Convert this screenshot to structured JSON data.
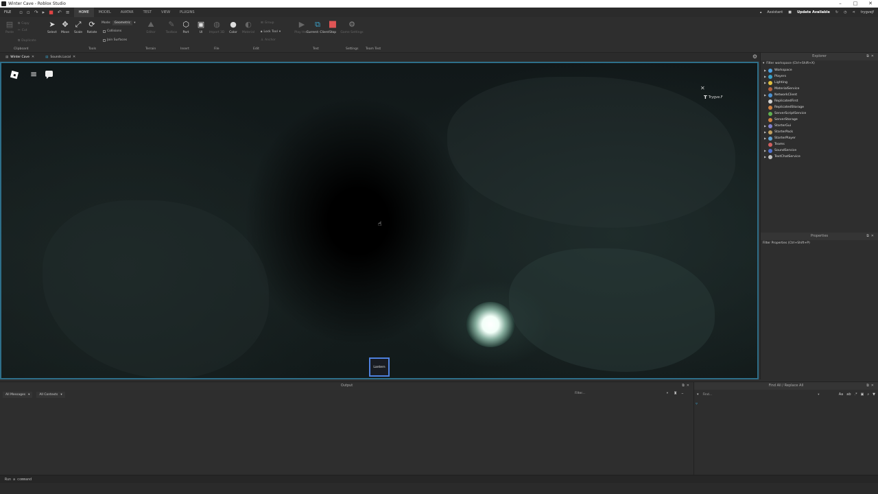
{
  "window": {
    "title": "Winter Cave - Roblox Studio",
    "min": "–",
    "max": "□",
    "close": "✕"
  },
  "menubar": {
    "file": "FILE",
    "tabs": [
      "HOME",
      "MODEL",
      "AVATAR",
      "TEST",
      "VIEW",
      "PLUGINS"
    ],
    "active_tab": "HOME",
    "assistant": "Assistant",
    "update": "Update Available",
    "user": "trygvejf"
  },
  "ribbon": {
    "paste": "Paste",
    "copy": "Copy",
    "cut": "Cut",
    "duplicate": "Duplicate",
    "select": "Select",
    "move": "Move",
    "scale": "Scale",
    "rotate": "Rotate",
    "mode_label": "Mode:",
    "mode_value": "Geometric",
    "collisions": "Collisions",
    "join_surfaces": "Join Surfaces",
    "editor": "Editor",
    "toolbox": "Toolbox",
    "part": "Part",
    "ui": "UI",
    "import3d": "Import 3D",
    "color": "Color",
    "material": "Material",
    "group": "Group",
    "lock_tool": "Lock Tool",
    "anchor": "Anchor",
    "play_here": "Play Here",
    "current_client": "Current: Client",
    "stop": "Stop",
    "game_settings": "Game Settings",
    "groups": [
      "Clipboard",
      "Tools",
      "Terrain",
      "Insert",
      "File",
      "Edit",
      "Test",
      "Settings",
      "Team Test"
    ]
  },
  "doc_tabs": [
    {
      "label": "Winter Cave",
      "active": true
    },
    {
      "label": "Sounds.Local",
      "active": false
    }
  ],
  "viewport": {
    "player_name": "Trygve.F",
    "hotbar_item": "Lantern"
  },
  "explorer": {
    "title": "Explorer",
    "filter": "Filter workspace (Ctrl+Shift+X)",
    "items": [
      {
        "label": "Workspace",
        "color": "#4a9fe0",
        "expandable": true
      },
      {
        "label": "Players",
        "color": "#3aa0c8",
        "expandable": true
      },
      {
        "label": "Lighting",
        "color": "#e0c040",
        "expandable": true
      },
      {
        "label": "MaterialService",
        "color": "#b06040",
        "expandable": false
      },
      {
        "label": "NetworkClient",
        "color": "#4a90d0",
        "expandable": true
      },
      {
        "label": "ReplicatedFirst",
        "color": "#d0d0d0",
        "expandable": false
      },
      {
        "label": "ReplicatedStorage",
        "color": "#d08040",
        "expandable": false
      },
      {
        "label": "ServerScriptService",
        "color": "#60b050",
        "expandable": false
      },
      {
        "label": "ServerStorage",
        "color": "#d08040",
        "expandable": false
      },
      {
        "label": "StarterGui",
        "color": "#8080d0",
        "expandable": true
      },
      {
        "label": "StarterPack",
        "color": "#c0a060",
        "expandable": true
      },
      {
        "label": "StarterPlayer",
        "color": "#60a0d0",
        "expandable": true
      },
      {
        "label": "Teams",
        "color": "#d06060",
        "expandable": false
      },
      {
        "label": "SoundService",
        "color": "#5070d0",
        "expandable": true
      },
      {
        "label": "TextChatService",
        "color": "#c0c0c0",
        "expandable": true
      }
    ]
  },
  "properties": {
    "title": "Properties",
    "filter": "Filter Properties (Ctrl+Shift+P)"
  },
  "output": {
    "title": "Output",
    "messages_filter": "All Messages",
    "contexts_filter": "All Contexts",
    "filter_placeholder": "Filter..."
  },
  "findall": {
    "title": "Find All / Replace All",
    "find_placeholder": "Find..."
  },
  "commandbar": {
    "placeholder": "Run a command"
  }
}
